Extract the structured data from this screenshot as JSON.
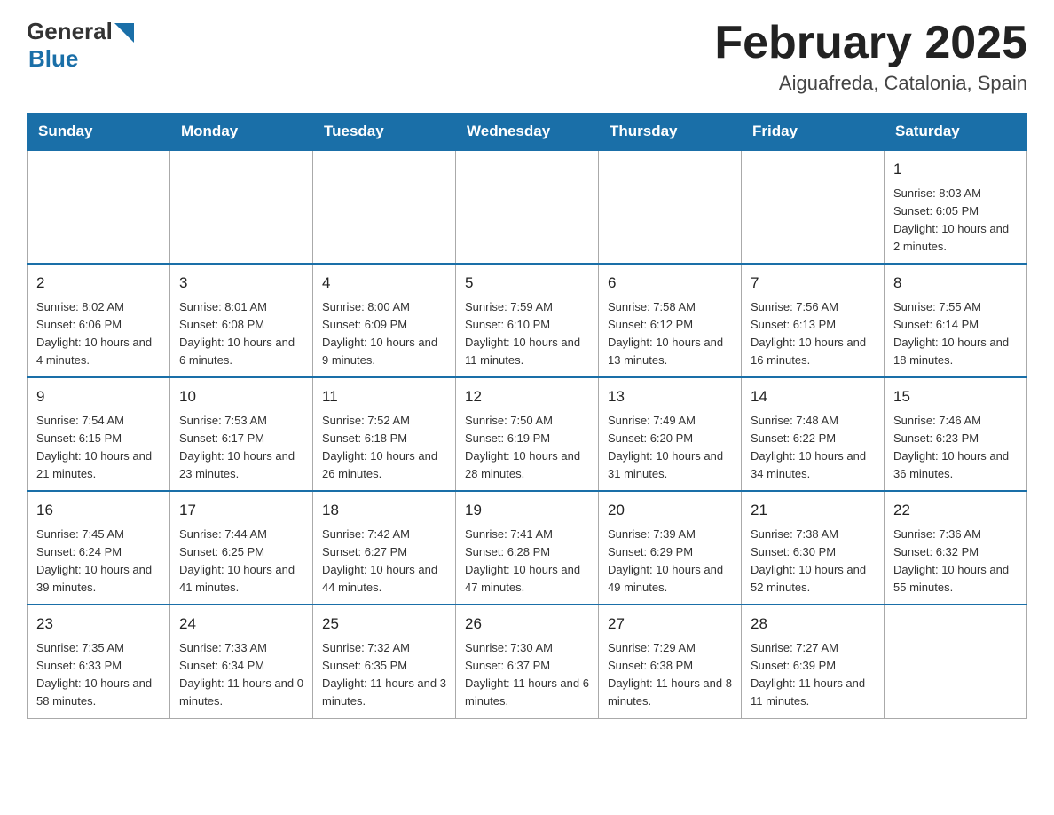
{
  "logo": {
    "general": "General",
    "blue": "Blue"
  },
  "header": {
    "title": "February 2025",
    "location": "Aiguafreda, Catalonia, Spain"
  },
  "days_of_week": [
    "Sunday",
    "Monday",
    "Tuesday",
    "Wednesday",
    "Thursday",
    "Friday",
    "Saturday"
  ],
  "weeks": [
    {
      "days": [
        {
          "date": "",
          "info": ""
        },
        {
          "date": "",
          "info": ""
        },
        {
          "date": "",
          "info": ""
        },
        {
          "date": "",
          "info": ""
        },
        {
          "date": "",
          "info": ""
        },
        {
          "date": "",
          "info": ""
        },
        {
          "date": "1",
          "info": "Sunrise: 8:03 AM\nSunset: 6:05 PM\nDaylight: 10 hours and 2 minutes."
        }
      ]
    },
    {
      "days": [
        {
          "date": "2",
          "info": "Sunrise: 8:02 AM\nSunset: 6:06 PM\nDaylight: 10 hours and 4 minutes."
        },
        {
          "date": "3",
          "info": "Sunrise: 8:01 AM\nSunset: 6:08 PM\nDaylight: 10 hours and 6 minutes."
        },
        {
          "date": "4",
          "info": "Sunrise: 8:00 AM\nSunset: 6:09 PM\nDaylight: 10 hours and 9 minutes."
        },
        {
          "date": "5",
          "info": "Sunrise: 7:59 AM\nSunset: 6:10 PM\nDaylight: 10 hours and 11 minutes."
        },
        {
          "date": "6",
          "info": "Sunrise: 7:58 AM\nSunset: 6:12 PM\nDaylight: 10 hours and 13 minutes."
        },
        {
          "date": "7",
          "info": "Sunrise: 7:56 AM\nSunset: 6:13 PM\nDaylight: 10 hours and 16 minutes."
        },
        {
          "date": "8",
          "info": "Sunrise: 7:55 AM\nSunset: 6:14 PM\nDaylight: 10 hours and 18 minutes."
        }
      ]
    },
    {
      "days": [
        {
          "date": "9",
          "info": "Sunrise: 7:54 AM\nSunset: 6:15 PM\nDaylight: 10 hours and 21 minutes."
        },
        {
          "date": "10",
          "info": "Sunrise: 7:53 AM\nSunset: 6:17 PM\nDaylight: 10 hours and 23 minutes."
        },
        {
          "date": "11",
          "info": "Sunrise: 7:52 AM\nSunset: 6:18 PM\nDaylight: 10 hours and 26 minutes."
        },
        {
          "date": "12",
          "info": "Sunrise: 7:50 AM\nSunset: 6:19 PM\nDaylight: 10 hours and 28 minutes."
        },
        {
          "date": "13",
          "info": "Sunrise: 7:49 AM\nSunset: 6:20 PM\nDaylight: 10 hours and 31 minutes."
        },
        {
          "date": "14",
          "info": "Sunrise: 7:48 AM\nSunset: 6:22 PM\nDaylight: 10 hours and 34 minutes."
        },
        {
          "date": "15",
          "info": "Sunrise: 7:46 AM\nSunset: 6:23 PM\nDaylight: 10 hours and 36 minutes."
        }
      ]
    },
    {
      "days": [
        {
          "date": "16",
          "info": "Sunrise: 7:45 AM\nSunset: 6:24 PM\nDaylight: 10 hours and 39 minutes."
        },
        {
          "date": "17",
          "info": "Sunrise: 7:44 AM\nSunset: 6:25 PM\nDaylight: 10 hours and 41 minutes."
        },
        {
          "date": "18",
          "info": "Sunrise: 7:42 AM\nSunset: 6:27 PM\nDaylight: 10 hours and 44 minutes."
        },
        {
          "date": "19",
          "info": "Sunrise: 7:41 AM\nSunset: 6:28 PM\nDaylight: 10 hours and 47 minutes."
        },
        {
          "date": "20",
          "info": "Sunrise: 7:39 AM\nSunset: 6:29 PM\nDaylight: 10 hours and 49 minutes."
        },
        {
          "date": "21",
          "info": "Sunrise: 7:38 AM\nSunset: 6:30 PM\nDaylight: 10 hours and 52 minutes."
        },
        {
          "date": "22",
          "info": "Sunrise: 7:36 AM\nSunset: 6:32 PM\nDaylight: 10 hours and 55 minutes."
        }
      ]
    },
    {
      "days": [
        {
          "date": "23",
          "info": "Sunrise: 7:35 AM\nSunset: 6:33 PM\nDaylight: 10 hours and 58 minutes."
        },
        {
          "date": "24",
          "info": "Sunrise: 7:33 AM\nSunset: 6:34 PM\nDaylight: 11 hours and 0 minutes."
        },
        {
          "date": "25",
          "info": "Sunrise: 7:32 AM\nSunset: 6:35 PM\nDaylight: 11 hours and 3 minutes."
        },
        {
          "date": "26",
          "info": "Sunrise: 7:30 AM\nSunset: 6:37 PM\nDaylight: 11 hours and 6 minutes."
        },
        {
          "date": "27",
          "info": "Sunrise: 7:29 AM\nSunset: 6:38 PM\nDaylight: 11 hours and 8 minutes."
        },
        {
          "date": "28",
          "info": "Sunrise: 7:27 AM\nSunset: 6:39 PM\nDaylight: 11 hours and 11 minutes."
        },
        {
          "date": "",
          "info": ""
        }
      ]
    }
  ]
}
